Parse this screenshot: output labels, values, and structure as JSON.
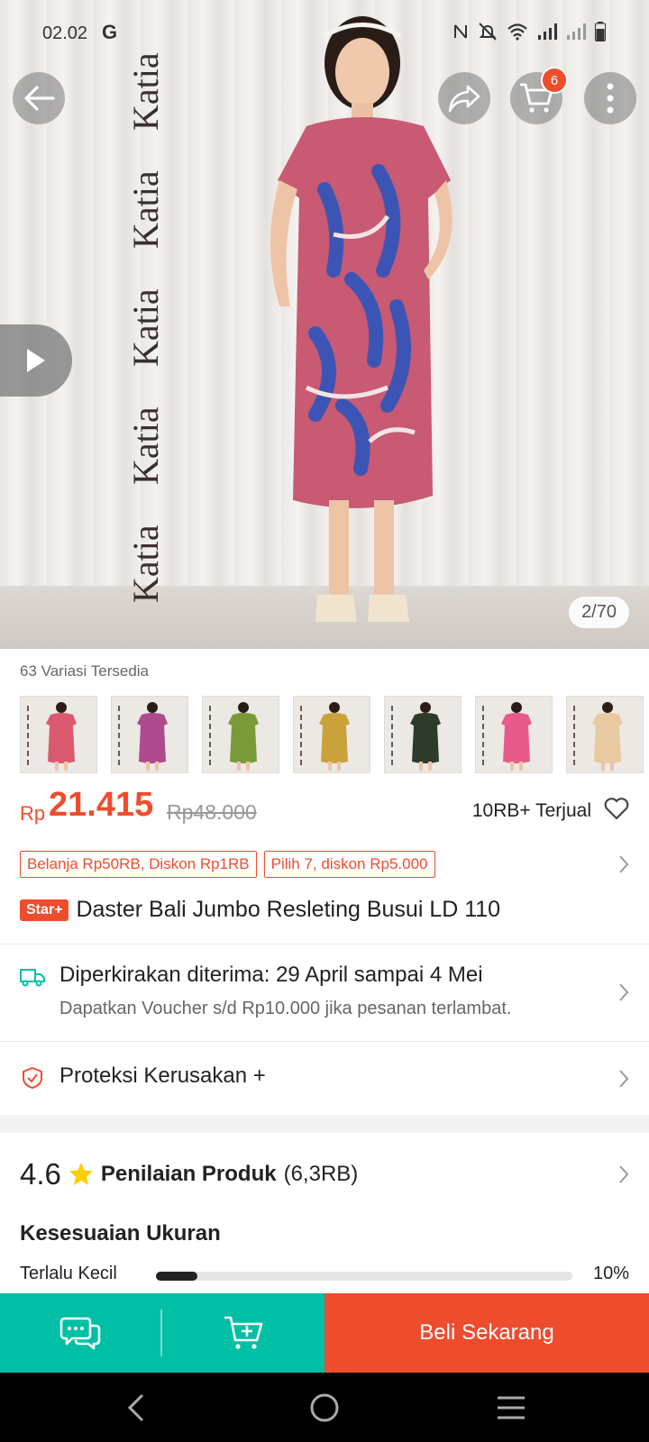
{
  "status_bar": {
    "time": "02.02",
    "carrier_glyph": "G",
    "icons": [
      "nfc-icon",
      "mute-icon",
      "wifi-icon",
      "signal-icon",
      "signal-icon",
      "battery-icon"
    ]
  },
  "hero": {
    "watermark": "Katia",
    "counter": "2/70",
    "cart_badge": "6"
  },
  "variations": {
    "label": "63 Variasi Tersedia",
    "thumb_colors": [
      "#d95a6e",
      "#b04a8f",
      "#7a9a3a",
      "#c9a23a",
      "#2d3b2a",
      "#e85a8a",
      "#e8c9a0"
    ]
  },
  "price": {
    "currency": "Rp",
    "value": "21.415",
    "original": "Rp48.000",
    "sold": "10RB+ Terjual"
  },
  "promos": [
    "Belanja Rp50RB, Diskon Rp1RB",
    "Pilih 7, diskon Rp5.000"
  ],
  "product": {
    "badge": "Star+",
    "title": "Daster Bali Jumbo Resleting Busui LD 110"
  },
  "shipping": {
    "title": "Diperkirakan diterima: 29 April sampai 4 Mei",
    "subtitle": "Dapatkan Voucher s/d Rp10.000 jika pesanan terlambat."
  },
  "protection": {
    "title": "Proteksi Kerusakan +"
  },
  "rating": {
    "score": "4.6",
    "title": "Penilaian Produk",
    "count": "(6,3RB)"
  },
  "fit": {
    "title": "Kesesuaian Ukuran",
    "rows": [
      {
        "label": "Terlalu Kecil",
        "percent_text": "10%",
        "fraction": 0.1
      }
    ]
  },
  "bottom_bar": {
    "buy_label": "Beli Sekarang"
  },
  "colors": {
    "accent": "#ee4d2d",
    "teal": "#00bfa5"
  }
}
